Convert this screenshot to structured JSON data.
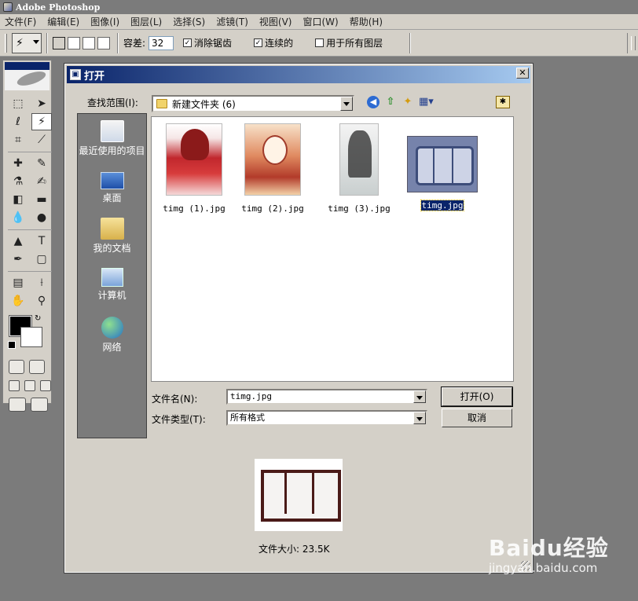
{
  "app": {
    "title": "Adobe Photoshop"
  },
  "menu": [
    "文件(F)",
    "编辑(E)",
    "图像(I)",
    "图层(L)",
    "选择(S)",
    "滤镜(T)",
    "视图(V)",
    "窗口(W)",
    "帮助(H)"
  ],
  "options": {
    "tolerance_label": "容差:",
    "tolerance_value": "32",
    "antialias_label": "消除锯齿",
    "antialias_checked": true,
    "contiguous_label": "连续的",
    "contiguous_checked": true,
    "alllayers_label": "用于所有图层",
    "alllayers_checked": false
  },
  "toolbox": {
    "tools": [
      {
        "name": "marquee-tool-icon",
        "glyph": "⬚"
      },
      {
        "name": "move-tool-icon",
        "glyph": "➤"
      },
      {
        "name": "lasso-tool-icon",
        "glyph": "ℓ"
      },
      {
        "name": "magic-wand-tool-icon",
        "glyph": "⚡"
      },
      {
        "name": "crop-tool-icon",
        "glyph": "⌗"
      },
      {
        "name": "slice-tool-icon",
        "glyph": "⟋"
      },
      {
        "name": "healing-brush-tool-icon",
        "glyph": "✚"
      },
      {
        "name": "brush-tool-icon",
        "glyph": "✎"
      },
      {
        "name": "stamp-tool-icon",
        "glyph": "⚗"
      },
      {
        "name": "history-brush-tool-icon",
        "glyph": "✍"
      },
      {
        "name": "eraser-tool-icon",
        "glyph": "◧"
      },
      {
        "name": "gradient-tool-icon",
        "glyph": "▬"
      },
      {
        "name": "blur-tool-icon",
        "glyph": "💧"
      },
      {
        "name": "dodge-tool-icon",
        "glyph": "●"
      },
      {
        "name": "path-select-tool-icon",
        "glyph": "▲"
      },
      {
        "name": "type-tool-icon",
        "glyph": "T"
      },
      {
        "name": "pen-tool-icon",
        "glyph": "✒"
      },
      {
        "name": "shape-tool-icon",
        "glyph": "▢"
      },
      {
        "name": "notes-tool-icon",
        "glyph": "▤"
      },
      {
        "name": "eyedropper-tool-icon",
        "glyph": "⟊"
      },
      {
        "name": "hand-tool-icon",
        "glyph": "✋"
      },
      {
        "name": "zoom-tool-icon",
        "glyph": "⚲"
      }
    ],
    "foreground_color": "#000000",
    "background_color": "#ffffff"
  },
  "dialog": {
    "title": "打开",
    "lookin_label": "查找范围(I):",
    "lookin_value": "新建文件夹 (6)",
    "places": [
      "最近使用的项目",
      "桌面",
      "我的文档",
      "计算机",
      "网络"
    ],
    "files": [
      {
        "name": "timg (1).jpg",
        "selected": false
      },
      {
        "name": "timg (2).jpg",
        "selected": false
      },
      {
        "name": "timg (3).jpg",
        "selected": false
      },
      {
        "name": "timg.jpg",
        "selected": true
      }
    ],
    "filename_label": "文件名(N):",
    "filename_value": "timg.jpg",
    "filetype_label": "文件类型(T):",
    "filetype_value": "所有格式",
    "open_button": "打开(O)",
    "cancel_button": "取消",
    "filesize_text": "文件大小: 23.5K"
  },
  "watermark": {
    "logo": "Baidu经验",
    "url": "jingyan.baidu.com"
  }
}
